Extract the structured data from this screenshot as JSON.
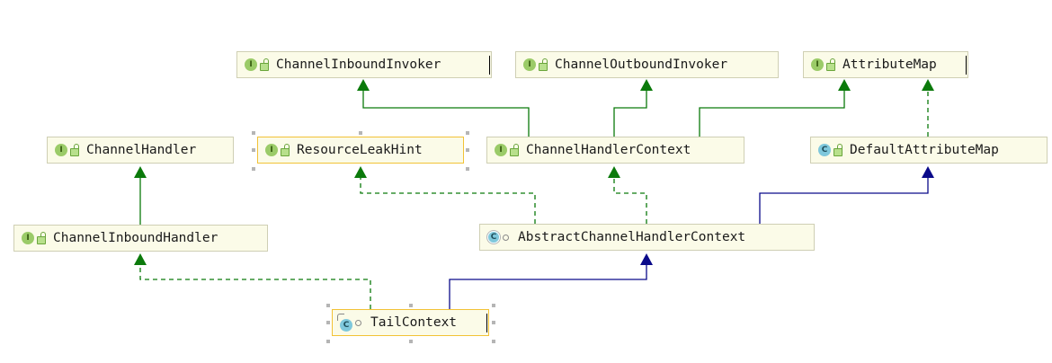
{
  "nodes": {
    "channel_inbound_invoker": {
      "label": "ChannelInboundInvoker",
      "kind": "interface",
      "badge": "I"
    },
    "channel_outbound_invoker": {
      "label": "ChannelOutboundInvoker",
      "kind": "interface",
      "badge": "I"
    },
    "attribute_map": {
      "label": "AttributeMap",
      "kind": "interface",
      "badge": "I"
    },
    "channel_handler": {
      "label": "ChannelHandler",
      "kind": "interface",
      "badge": "I"
    },
    "resource_leak_hint": {
      "label": "ResourceLeakHint",
      "kind": "interface",
      "badge": "I"
    },
    "channel_handler_context": {
      "label": "ChannelHandlerContext",
      "kind": "interface",
      "badge": "I"
    },
    "default_attribute_map": {
      "label": "DefaultAttributeMap",
      "kind": "class",
      "badge": "C"
    },
    "channel_inbound_handler": {
      "label": "ChannelInboundHandler",
      "kind": "interface",
      "badge": "I"
    },
    "abstract_channel_handler_context": {
      "label": "AbstractChannelHandlerContext",
      "kind": "abstract class",
      "badge": "C"
    },
    "tail_context": {
      "label": "TailContext",
      "kind": "class",
      "badge": "C"
    }
  },
  "edges": [
    {
      "from": "channel_handler_context",
      "to": "channel_inbound_invoker",
      "type": "extends"
    },
    {
      "from": "channel_handler_context",
      "to": "channel_outbound_invoker",
      "type": "extends"
    },
    {
      "from": "channel_handler_context",
      "to": "attribute_map",
      "type": "extends"
    },
    {
      "from": "default_attribute_map",
      "to": "attribute_map",
      "type": "implements"
    },
    {
      "from": "channel_inbound_handler",
      "to": "channel_handler",
      "type": "extends"
    },
    {
      "from": "abstract_channel_handler_context",
      "to": "resource_leak_hint",
      "type": "implements"
    },
    {
      "from": "abstract_channel_handler_context",
      "to": "channel_handler_context",
      "type": "implements"
    },
    {
      "from": "abstract_channel_handler_context",
      "to": "default_attribute_map",
      "type": "extends-class"
    },
    {
      "from": "tail_context",
      "to": "channel_inbound_handler",
      "type": "implements"
    },
    {
      "from": "tail_context",
      "to": "abstract_channel_handler_context",
      "type": "extends-class"
    }
  ],
  "colors": {
    "interface_edge": "#0b7a0b",
    "class_edge": "#0a0a8a",
    "node_fill": "#fbfbe8",
    "node_border": "#cfcfb4",
    "selected_border": "#f2c236",
    "interface_badge": "#9bcb68",
    "class_badge": "#7fc8dc"
  },
  "icons": {
    "interface": "interface-icon",
    "class": "class-icon",
    "abstract": "abstract-class-icon",
    "public": "public-visibility-icon",
    "package": "package-private-icon"
  }
}
